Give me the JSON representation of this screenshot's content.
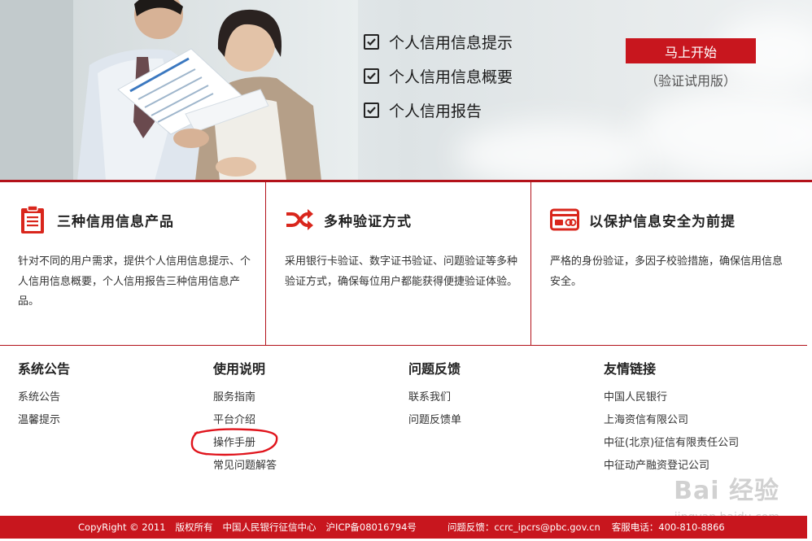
{
  "banner": {
    "features": [
      "个人信用信息提示",
      "个人信用信息概要",
      "个人信用报告"
    ],
    "start_button": "马上开始",
    "trial_note": "（验证试用版）"
  },
  "info": {
    "products": {
      "title": "三种信用信息产品",
      "desc": "针对不同的用户需求，提供个人信用信息提示、个人信用信息概要，个人信用报告三种信用信息产品。"
    },
    "verify": {
      "title": "多种验证方式",
      "desc": "采用银行卡验证、数字证书验证、问题验证等多种验证方式，确保每位用户都能获得便捷验证体验。"
    },
    "security": {
      "title": "以保护信息安全为前提",
      "desc": "严格的身份验证，多因子校验措施，确保信用信息安全。"
    }
  },
  "footer_links": {
    "announce": {
      "title": "系统公告",
      "items": [
        "系统公告",
        "温馨提示"
      ]
    },
    "usage": {
      "title": "使用说明",
      "items": [
        "服务指南",
        "平台介绍",
        "操作手册",
        "常见问题解答"
      ]
    },
    "feedback": {
      "title": "问题反馈",
      "items": [
        "联系我们",
        "问题反馈单"
      ]
    },
    "friends": {
      "title": "友情链接",
      "items": [
        "中国人民银行",
        "上海资信有限公司",
        "中征(北京)征信有限责任公司",
        "中征动产融资登记公司"
      ]
    }
  },
  "watermark": {
    "logo": "Bai 经验",
    "url": "jingyan.baidu.com"
  },
  "bottom_bar": {
    "copyright": "CopyRight © 2011",
    "rights": "版权所有",
    "org": "中国人民银行征信中心",
    "icp": "沪ICP备08016794号",
    "feedback": "问题反馈：ccrc_ipcrs@pbc.gov.cn",
    "hotline": "客服电话：400-810-8866"
  },
  "colors": {
    "brand_red": "#c8161e",
    "rule_red": "#b3121a",
    "icon_red": "#d9261c"
  }
}
